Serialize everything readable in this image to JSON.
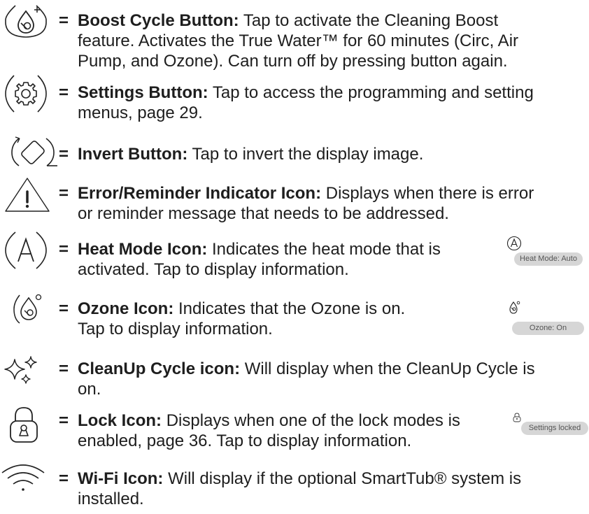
{
  "legend": {
    "items": [
      {
        "icon": "boost-cycle-icon",
        "term": "Boost Cycle Button:",
        "description": "Tap to activate the Cleaning Boost feature. Activates the True Water™ for 60 minutes (Circ, Air Pump, and Ozone). Can turn off by pressing button again.",
        "lines": [
          "Tap to activate the Cleaning Boost",
          "feature. Activates the True Water™ for 60 minutes (Circ, Air",
          "Pump, and Ozone). Can turn off by pressing button again."
        ]
      },
      {
        "icon": "gear-icon",
        "term": "Settings Button:",
        "lines": [
          "Tap to access the programming and setting",
          "menus, page 29."
        ]
      },
      {
        "icon": "invert-icon",
        "term": "Invert Button:",
        "lines": [
          "Tap to invert the display image."
        ]
      },
      {
        "icon": "warning-triangle-icon",
        "term": "Error/Reminder Indicator Icon:",
        "lines": [
          "Displays when there is error",
          "or reminder message that needs to be addressed."
        ]
      },
      {
        "icon": "heat-mode-auto-icon",
        "term": "Heat Mode Icon:",
        "lines": [
          "Indicates the heat mode that is",
          "activated. Tap to display information."
        ],
        "example": {
          "icon_letter": "A",
          "label": "Heat Mode: Auto"
        }
      },
      {
        "icon": "ozone-icon",
        "term": "Ozone Icon:",
        "lines": [
          "Indicates that the Ozone is on.",
          "Tap to display information."
        ],
        "example": {
          "label": "Ozone: On"
        }
      },
      {
        "icon": "cleanup-sparkle-icon",
        "term": "CleanUp Cycle icon:",
        "lines": [
          "Will display when the CleanUp Cycle is",
          "on."
        ]
      },
      {
        "icon": "lock-icon",
        "term": "Lock Icon:",
        "lines": [
          "Displays when one of the lock modes is",
          "enabled, page 36. Tap to display information."
        ],
        "example": {
          "label": "Settings locked"
        }
      },
      {
        "icon": "wifi-icon",
        "term": "Wi-Fi Icon:",
        "lines": [
          "Will display if the optional SmartTub® system is",
          "installed."
        ]
      }
    ],
    "equals": "="
  },
  "colors": {
    "text": "#1e1e1e",
    "pill_bg": "#d6d6d6",
    "pill_text": "#555555"
  }
}
